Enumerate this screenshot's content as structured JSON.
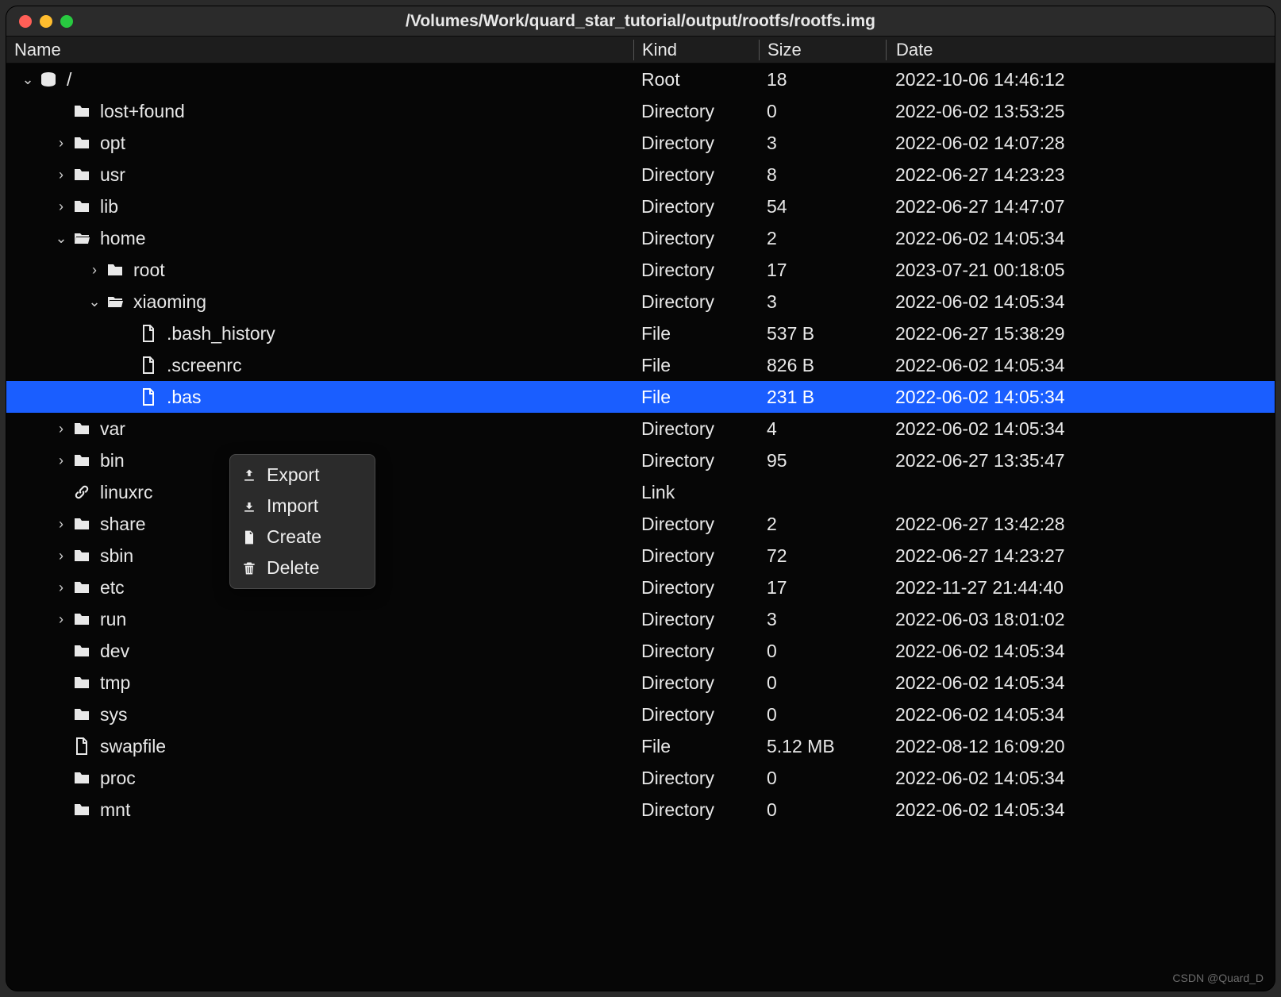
{
  "window_title": "/Volumes/Work/quard_star_tutorial/output/rootfs/rootfs.img",
  "columns": {
    "name": "Name",
    "kind": "Kind",
    "size": "Size",
    "date": "Date"
  },
  "context_menu": {
    "export": "Export",
    "import": "Import",
    "create": "Create",
    "delete": "Delete"
  },
  "watermark": "CSDN @Quard_D",
  "rows": [
    {
      "indent": 0,
      "chev": "down",
      "icon": "disk",
      "name": "/",
      "kind": "Root",
      "size": "18",
      "date": "2022-10-06 14:46:12",
      "selected": false
    },
    {
      "indent": 1,
      "chev": "none",
      "icon": "folder",
      "name": "lost+found",
      "kind": "Directory",
      "size": "0",
      "date": "2022-06-02 13:53:25",
      "selected": false
    },
    {
      "indent": 1,
      "chev": "right",
      "icon": "folder",
      "name": "opt",
      "kind": "Directory",
      "size": "3",
      "date": "2022-06-02 14:07:28",
      "selected": false
    },
    {
      "indent": 1,
      "chev": "right",
      "icon": "folder",
      "name": "usr",
      "kind": "Directory",
      "size": "8",
      "date": "2022-06-27 14:23:23",
      "selected": false
    },
    {
      "indent": 1,
      "chev": "right",
      "icon": "folder",
      "name": "lib",
      "kind": "Directory",
      "size": "54",
      "date": "2022-06-27 14:47:07",
      "selected": false
    },
    {
      "indent": 1,
      "chev": "down",
      "icon": "folder-open",
      "name": "home",
      "kind": "Directory",
      "size": "2",
      "date": "2022-06-02 14:05:34",
      "selected": false
    },
    {
      "indent": 2,
      "chev": "right",
      "icon": "folder",
      "name": "root",
      "kind": "Directory",
      "size": "17",
      "date": "2023-07-21 00:18:05",
      "selected": false
    },
    {
      "indent": 2,
      "chev": "down",
      "icon": "folder-open",
      "name": "xiaoming",
      "kind": "Directory",
      "size": "3",
      "date": "2022-06-02 14:05:34",
      "selected": false
    },
    {
      "indent": 3,
      "chev": "none",
      "icon": "file",
      "name": ".bash_history",
      "kind": "File",
      "size": "537 B",
      "date": "2022-06-27 15:38:29",
      "selected": false
    },
    {
      "indent": 3,
      "chev": "none",
      "icon": "file",
      "name": ".screenrc",
      "kind": "File",
      "size": "826 B",
      "date": "2022-06-02 14:05:34",
      "selected": false
    },
    {
      "indent": 3,
      "chev": "none",
      "icon": "file",
      "name": ".bas",
      "kind": "File",
      "size": "231 B",
      "date": "2022-06-02 14:05:34",
      "selected": true
    },
    {
      "indent": 1,
      "chev": "right",
      "icon": "folder",
      "name": "var",
      "kind": "Directory",
      "size": "4",
      "date": "2022-06-02 14:05:34",
      "selected": false
    },
    {
      "indent": 1,
      "chev": "right",
      "icon": "folder",
      "name": "bin",
      "kind": "Directory",
      "size": "95",
      "date": "2022-06-27 13:35:47",
      "selected": false
    },
    {
      "indent": 1,
      "chev": "none",
      "icon": "link",
      "name": "linuxrc",
      "kind": "Link",
      "size": "",
      "date": "",
      "selected": false
    },
    {
      "indent": 1,
      "chev": "right",
      "icon": "folder",
      "name": "share",
      "kind": "Directory",
      "size": "2",
      "date": "2022-06-27 13:42:28",
      "selected": false
    },
    {
      "indent": 1,
      "chev": "right",
      "icon": "folder",
      "name": "sbin",
      "kind": "Directory",
      "size": "72",
      "date": "2022-06-27 14:23:27",
      "selected": false
    },
    {
      "indent": 1,
      "chev": "right",
      "icon": "folder",
      "name": "etc",
      "kind": "Directory",
      "size": "17",
      "date": "2022-11-27 21:44:40",
      "selected": false
    },
    {
      "indent": 1,
      "chev": "right",
      "icon": "folder",
      "name": "run",
      "kind": "Directory",
      "size": "3",
      "date": "2022-06-03 18:01:02",
      "selected": false
    },
    {
      "indent": 1,
      "chev": "none",
      "icon": "folder",
      "name": "dev",
      "kind": "Directory",
      "size": "0",
      "date": "2022-06-02 14:05:34",
      "selected": false
    },
    {
      "indent": 1,
      "chev": "none",
      "icon": "folder",
      "name": "tmp",
      "kind": "Directory",
      "size": "0",
      "date": "2022-06-02 14:05:34",
      "selected": false
    },
    {
      "indent": 1,
      "chev": "none",
      "icon": "folder",
      "name": "sys",
      "kind": "Directory",
      "size": "0",
      "date": "2022-06-02 14:05:34",
      "selected": false
    },
    {
      "indent": 1,
      "chev": "none",
      "icon": "file",
      "name": "swapfile",
      "kind": "File",
      "size": "5.12 MB",
      "date": "2022-08-12 16:09:20",
      "selected": false
    },
    {
      "indent": 1,
      "chev": "none",
      "icon": "folder",
      "name": "proc",
      "kind": "Directory",
      "size": "0",
      "date": "2022-06-02 14:05:34",
      "selected": false
    },
    {
      "indent": 1,
      "chev": "none",
      "icon": "folder",
      "name": "mnt",
      "kind": "Directory",
      "size": "0",
      "date": "2022-06-02 14:05:34",
      "selected": false
    }
  ]
}
